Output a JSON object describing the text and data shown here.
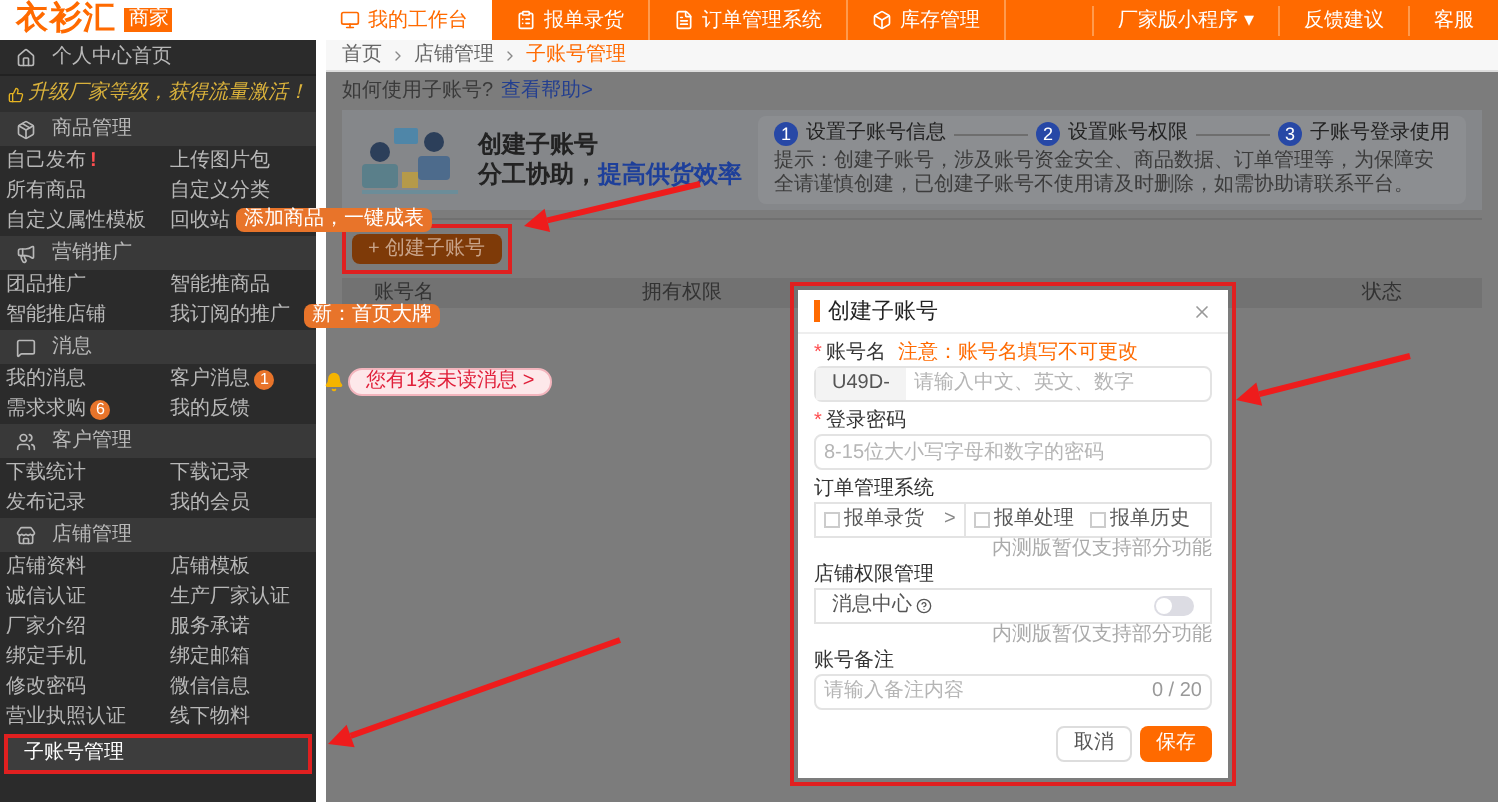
{
  "logo": {
    "name": "衣衫汇",
    "badge": "商家"
  },
  "top_nav": {
    "tabs": [
      {
        "label": "我的工作台",
        "selected": true
      },
      {
        "label": "报单录货",
        "selected": false
      },
      {
        "label": "订单管理系统",
        "selected": false
      },
      {
        "label": "库存管理",
        "selected": false
      }
    ],
    "links": [
      "厂家版小程序 ▾",
      "反馈建议",
      "客服"
    ]
  },
  "sidebar": {
    "home": "个人中心首页",
    "promo": "升级厂家等级，获得流量激活！",
    "sections": [
      {
        "title": "商品管理",
        "items": [
          {
            "label": "自己发布",
            "flag": "!"
          },
          {
            "label": "上传图片包"
          },
          {
            "label": "所有商品"
          },
          {
            "label": "自定义分类"
          },
          {
            "label": "自定义属性模板"
          },
          {
            "label": "回收站"
          }
        ]
      },
      {
        "title": "营销推广",
        "items": [
          {
            "label": "团品推广"
          },
          {
            "label": "智能推商品"
          },
          {
            "label": "智能推店铺"
          },
          {
            "label": "我订阅的推广"
          }
        ]
      },
      {
        "title": "消息",
        "items": [
          {
            "label": "我的消息"
          },
          {
            "label": "客户消息",
            "badge": "1"
          },
          {
            "label": "需求求购",
            "badge": "6"
          },
          {
            "label": "我的反馈"
          }
        ]
      },
      {
        "title": "客户管理",
        "items": [
          {
            "label": "下载统计"
          },
          {
            "label": "下载记录"
          },
          {
            "label": "发布记录"
          },
          {
            "label": "我的会员"
          }
        ]
      },
      {
        "title": "店铺管理",
        "items": [
          {
            "label": "店铺资料"
          },
          {
            "label": "店铺模板"
          },
          {
            "label": "诚信认证"
          },
          {
            "label": "生产厂家认证"
          },
          {
            "label": "厂家介绍"
          },
          {
            "label": "服务承诺"
          },
          {
            "label": "绑定手机"
          },
          {
            "label": "绑定邮箱"
          },
          {
            "label": "修改密码"
          },
          {
            "label": "微信信息"
          },
          {
            "label": "营业执照认证"
          },
          {
            "label": "线下物料"
          }
        ]
      }
    ],
    "bottom_item": {
      "label": "子账号管理",
      "selected": true
    }
  },
  "tooltips": [
    {
      "kind": "orange",
      "text": "添加商品，一键成表"
    },
    {
      "kind": "orange",
      "text": "新：首页大牌"
    },
    {
      "kind": "pink",
      "text": "您有1条未读消息 >"
    }
  ],
  "breadcrumb": [
    {
      "label": "首页",
      "selected": false
    },
    {
      "label": "店铺管理",
      "selected": false
    },
    {
      "label": "子账号管理",
      "selected": true
    }
  ],
  "help": {
    "text": "如何使用子账号?",
    "link": "查看帮助>"
  },
  "banner": {
    "title": "创建子账号",
    "subtitle": "分工协助，",
    "highlight": "提高供货效率",
    "steps": [
      {
        "number": "1",
        "label": "设置子账号信息"
      },
      {
        "number": "2",
        "label": "设置账号权限"
      },
      {
        "number": "3",
        "label": "子账号登录使用"
      }
    ],
    "tip": "提示：创建子账号，涉及账号资金安全、商品数据、订单管理等，为保障安全请谨慎创建，已创建子账号不使用请及时删除，如需协助请联系平台。"
  },
  "create_button": "+ 创建子账号",
  "table": {
    "columns": [
      "账号名",
      "拥有权限",
      "状态"
    ]
  },
  "modal": {
    "title": "创建子账号",
    "account": {
      "label": "账号名",
      "required_mark": "*",
      "note": "注意：账号名填写不可更改",
      "prefix": "U49D-",
      "placeholder": "请输入中文、英文、数字"
    },
    "password": {
      "label": "登录密码",
      "required_mark": "*",
      "placeholder": "8-15位大小写字母和数字的密码"
    },
    "orders": {
      "label": "订单管理系统",
      "options": [
        {
          "label": "报单录货",
          "checked": false,
          "arrow": ">"
        },
        {
          "label": "报单处理",
          "checked": false
        },
        {
          "label": "报单历史",
          "checked": false
        }
      ],
      "hint": "内测版暂仅支持部分功能"
    },
    "shop": {
      "label": "店铺权限管理",
      "item": "消息中心",
      "on": false,
      "hint": "内测版暂仅支持部分功能"
    },
    "remark": {
      "label": "账号备注",
      "placeholder": "请输入备注内容",
      "count": "0 / 20"
    },
    "buttons": [
      "取消",
      "保存"
    ]
  }
}
